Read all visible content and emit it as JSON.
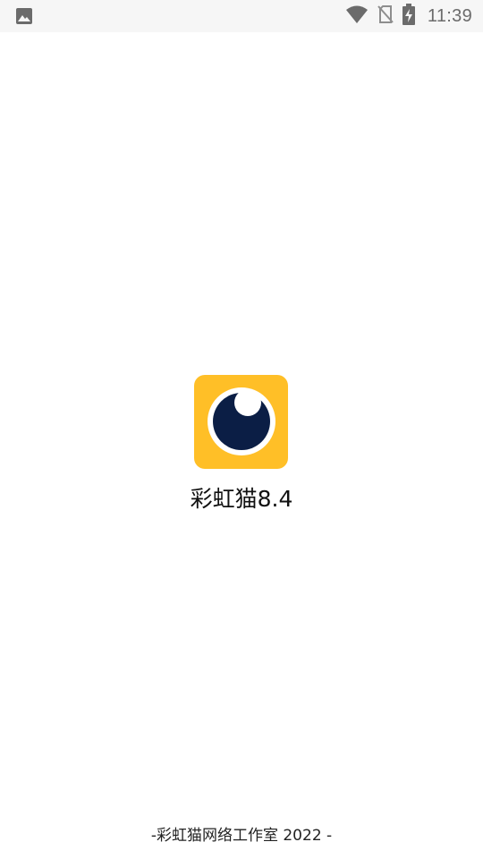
{
  "status_bar": {
    "time": "11:39",
    "icons": [
      "image-icon",
      "wifi-icon",
      "no-sim-icon",
      "battery-charging-icon"
    ]
  },
  "splash": {
    "app_name": "彩虹猫8.4",
    "footer": "-彩虹猫网络工作室 2022 -",
    "icon_name": "eye-logo-icon"
  },
  "colors": {
    "status_bar_bg": "#f6f6f6",
    "status_icons": "#6b6b6b",
    "icon_bg": "#ffbf27",
    "eye_pupil": "#0b1e45",
    "eye_ring": "#ffffff"
  }
}
